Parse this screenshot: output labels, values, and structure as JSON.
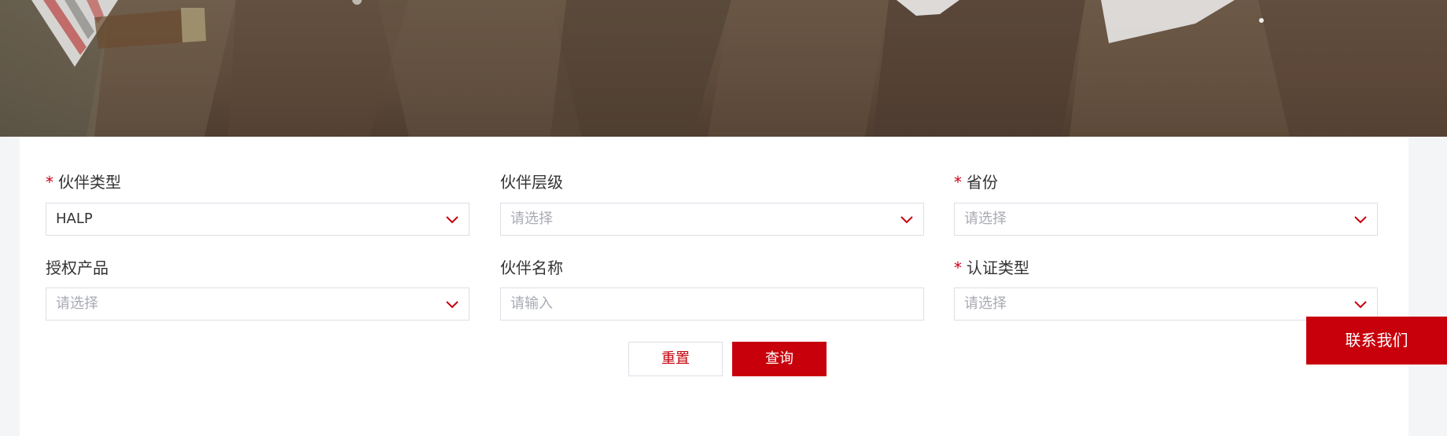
{
  "filters": {
    "partner_type": {
      "label": "伙伴类型",
      "required": true,
      "value": "HALP"
    },
    "partner_level": {
      "label": "伙伴层级",
      "required": false,
      "placeholder": "请选择"
    },
    "province": {
      "label": "省份",
      "required": true,
      "placeholder": "请选择"
    },
    "authorized_product": {
      "label": "授权产品",
      "required": false,
      "placeholder": "请选择"
    },
    "partner_name": {
      "label": "伙伴名称",
      "required": false,
      "placeholder": "请输入"
    },
    "cert_type": {
      "label": "认证类型",
      "required": true,
      "placeholder": "请选择"
    }
  },
  "required_mark": "*",
  "buttons": {
    "reset": "重置",
    "query": "查询"
  },
  "contact": {
    "label": "联系我们"
  },
  "colors": {
    "accent": "#c7000b",
    "border": "#dcdfe6",
    "placeholder": "#a8abb2"
  },
  "icons": {
    "dropdown": "chevron-down-icon"
  }
}
